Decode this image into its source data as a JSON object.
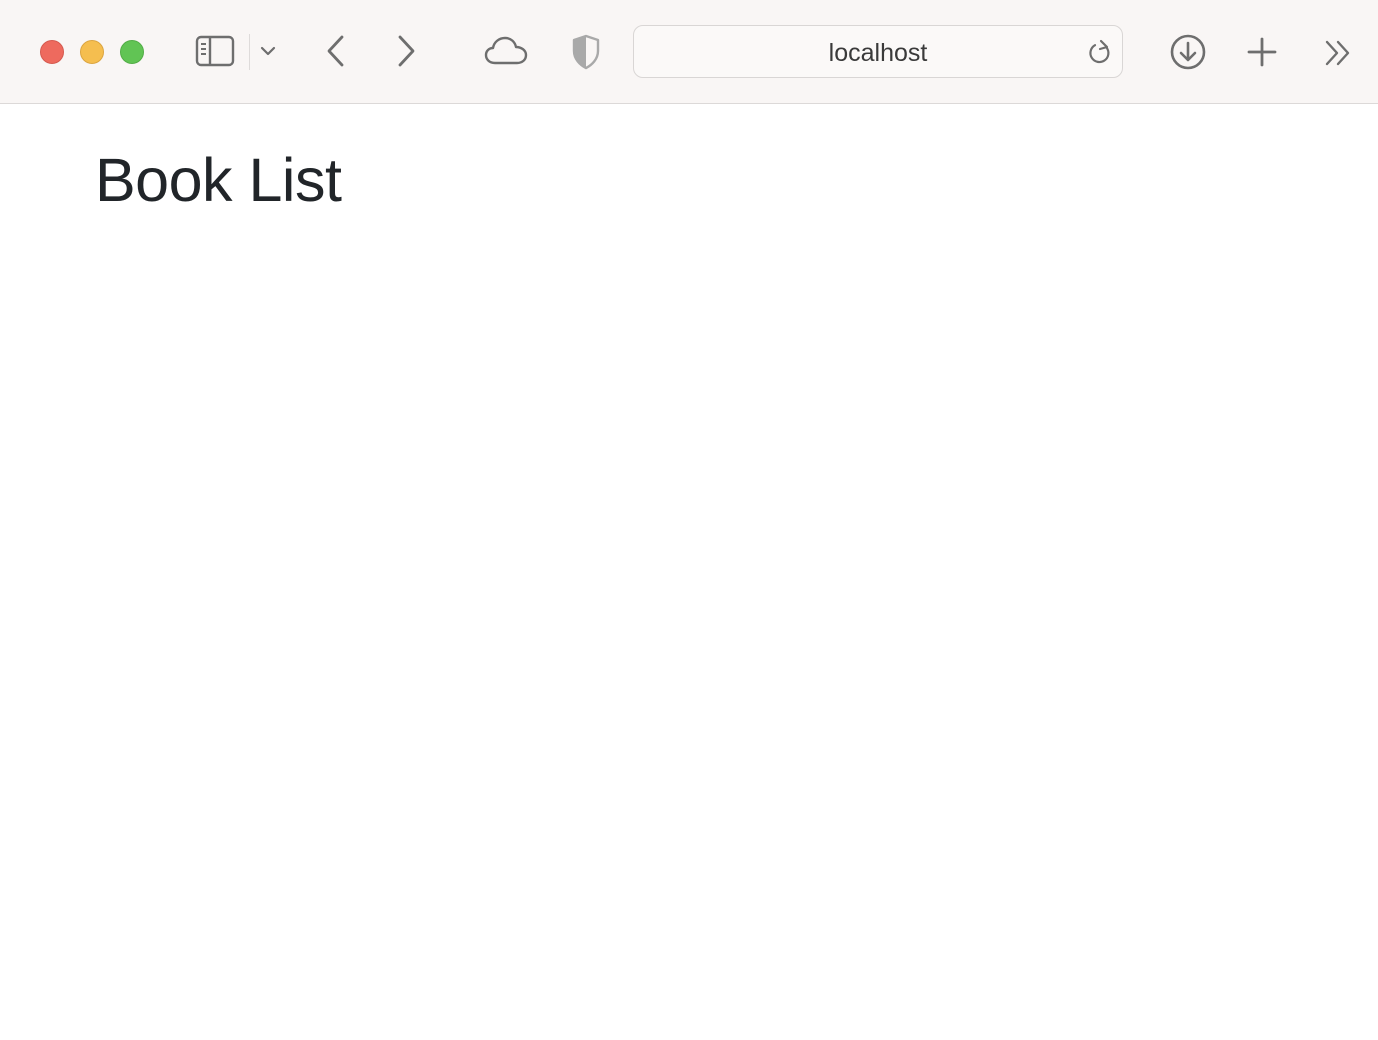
{
  "browser": {
    "address": "localhost",
    "icons": {
      "sidebar": "sidebar-icon",
      "sidebar_menu": "chevron-down-icon",
      "back": "chevron-left-icon",
      "forward": "chevron-right-icon",
      "icloud": "cloud-icon",
      "privacy": "shield-icon",
      "reload": "reload-icon",
      "downloads": "download-icon",
      "new_tab": "plus-icon",
      "more": "double-chevron-right-icon"
    },
    "colors": {
      "close": "#ee6a5e",
      "minimize": "#f5be4f",
      "zoom": "#61c454",
      "toolbar_bg": "#f9f6f5"
    }
  },
  "page": {
    "title": "Book List",
    "title_color": "#212529"
  }
}
